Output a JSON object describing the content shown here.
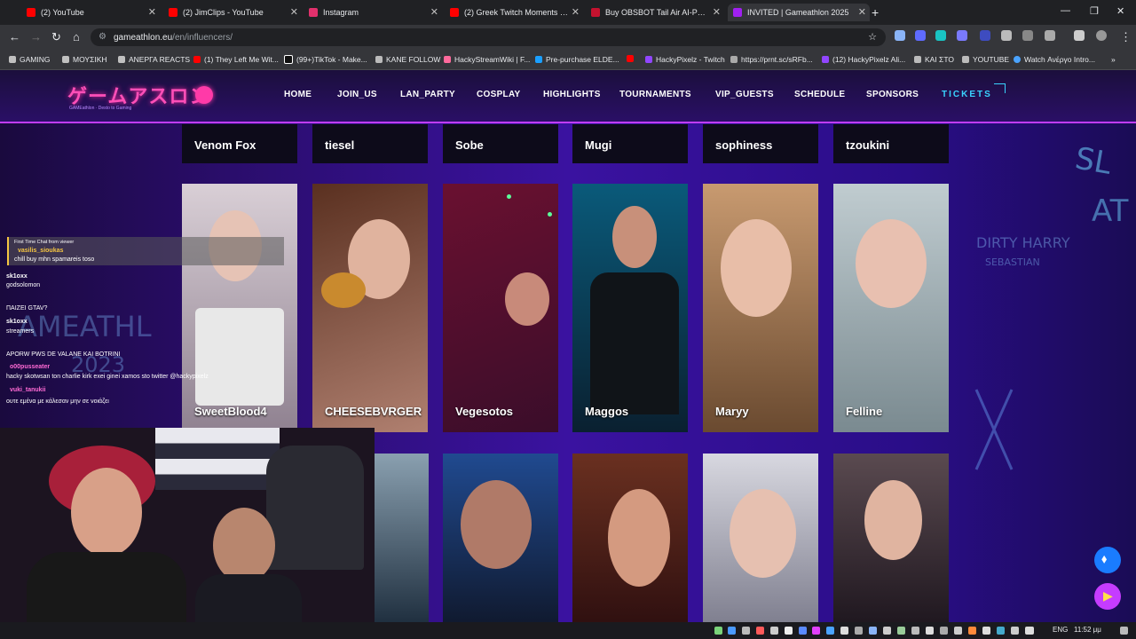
{
  "tabs": [
    {
      "title": "(2) YouTube",
      "color": "#ff0000"
    },
    {
      "title": "(2) JimClips - YouTube",
      "color": "#ff0000"
    },
    {
      "title": "Instagram",
      "color": "#e1306c"
    },
    {
      "title": "(2) Greek Twitch Moments #12...",
      "color": "#ff0000"
    },
    {
      "title": "Buy OBSBOT Tail Air AI-Powere...",
      "color": "#c4122f"
    },
    {
      "title": "INVITED | Gameathlon 2025",
      "color": "#a020f0"
    }
  ],
  "window_controls": {
    "minimize": "—",
    "restore": "❐",
    "close": "✕"
  },
  "url": {
    "host": "gameathlon.eu",
    "path": "/en/influencers/"
  },
  "bookmarks": [
    "GAMING",
    "ΜΟΥΣΙΚΗ",
    "ΑΝΕΡΓΑ REACTS",
    "(1) They Left Me Wit...",
    "(99+)TikTok - Make...",
    "KANE FOLLOW",
    "HackyStreamWiki | F...",
    "Pre-purchase ELDE...",
    "",
    "HackyPixelz - Twitch",
    "https://prnt.sc/sRFb...",
    "(12) HackyPixelz Ali...",
    "ΚΑΙ ΣΤΟ",
    "YOUTUBE",
    "Watch Ανέργο Intro..."
  ],
  "site": {
    "logo_text": "ゲームアスロン",
    "logo_sub": "GAMEathlon · Desto to Gaming",
    "nav": [
      "HOME",
      "JOIN_US",
      "LAN_PARTY",
      "COSPLAY",
      "HIGHLIGHTS",
      "TOURNAMENTS",
      "VIP_GUESTS",
      "SCHEDULE",
      "SPONSORS",
      "TICKETS"
    ]
  },
  "row1_names": [
    "Venom Fox",
    "tiesel",
    "Sobe",
    "Mugi",
    "sophiness",
    "tzoukini"
  ],
  "row2_names": [
    "SweetBlood4",
    "CHEESEBVRGER",
    "Vegesotos",
    "Maggos",
    "Maryy",
    "Felline"
  ],
  "chat": {
    "first_label": "First Time Chat from viewer",
    "first_user": "vasilis_sioukas",
    "first_msg": "chill buy mhn spamareis toso",
    "lines": [
      {
        "user": "sk1oxx",
        "msg": "godsolomon"
      },
      {
        "user": "",
        "msg": "ΠΑΙΖΕΙ GTAV?"
      },
      {
        "user": "sk1oxx",
        "msg": "streamers"
      },
      {
        "user": "",
        "msg": "APORW PWS DE VALANE KAI BOTRINI"
      },
      {
        "user": "o00pusseater",
        "msg": "hacky skotwsan ton charlie kirk exei ginei xamos sto twitter @hackypixelz"
      },
      {
        "user": "vuki_tanukii",
        "msg": "ουτε εμένα με κάλεσαν μην σε νοιάζει"
      }
    ]
  },
  "clock": "11:52 μμ",
  "lang": "ENG",
  "colors": {
    "accent": "#c03cff",
    "tickets": "#39d3ff",
    "logo": "#ff4fb8"
  }
}
